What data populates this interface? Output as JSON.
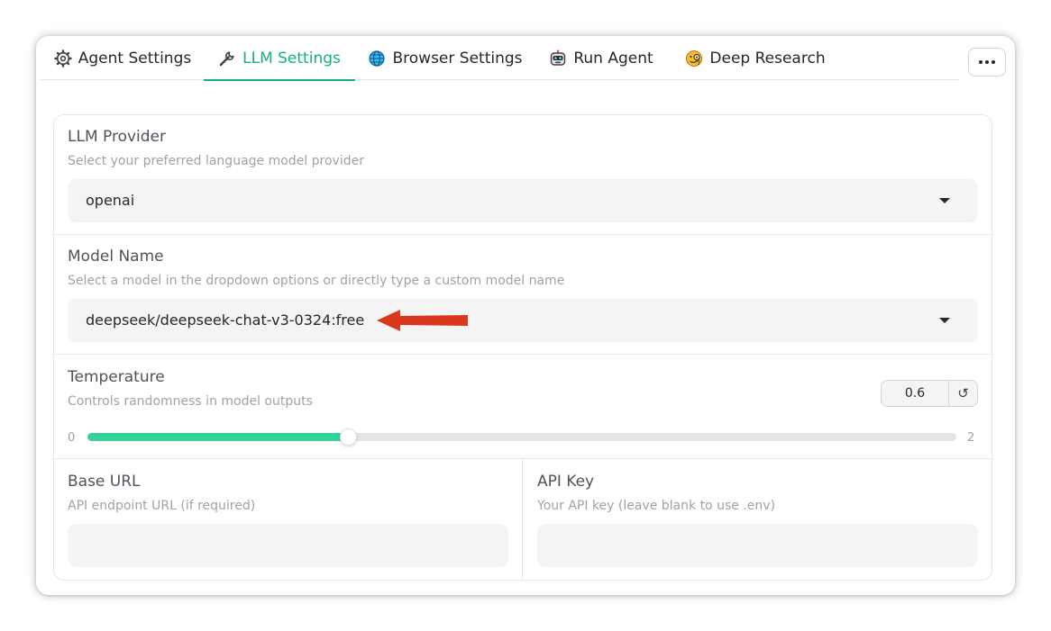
{
  "tabs": [
    {
      "label": "Agent Settings",
      "icon": "gear-icon"
    },
    {
      "label": "LLM Settings",
      "icon": "wrench-icon",
      "active": true
    },
    {
      "label": "Browser Settings",
      "icon": "globe-icon"
    },
    {
      "label": "Run Agent",
      "icon": "robot-icon"
    },
    {
      "label": "Deep Research",
      "icon": "face-with-monocle-icon"
    }
  ],
  "llm_provider": {
    "label": "LLM Provider",
    "info": "Select your preferred language model provider",
    "value": "openai"
  },
  "model_name": {
    "label": "Model Name",
    "info": "Select a model in the dropdown options or directly type a custom model name",
    "value": "deepseek/deepseek-chat-v3-0324:free"
  },
  "temperature": {
    "label": "Temperature",
    "info": "Controls randomness in model outputs",
    "value": "0.6",
    "min": "0",
    "max": "2",
    "fraction": 0.3
  },
  "base_url": {
    "label": "Base URL",
    "info": "API endpoint URL (if required)",
    "value": ""
  },
  "api_key": {
    "label": "API Key",
    "info": "Your API key (leave blank to use .env)",
    "value": ""
  },
  "colors": {
    "accent": "#16b07c",
    "slider_fill": "#34d399",
    "annotation_arrow": "#d9381e"
  }
}
